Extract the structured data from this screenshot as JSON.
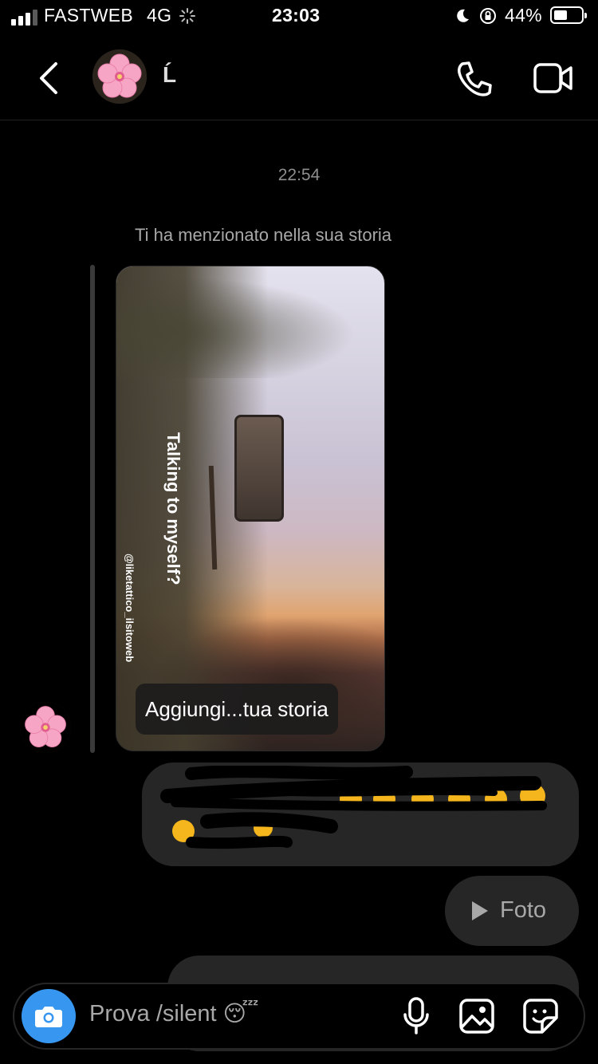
{
  "status_bar": {
    "carrier": "FASTWEB",
    "network": "4G",
    "time": "23:03",
    "battery": "44%",
    "battery_level": 0.44
  },
  "header": {
    "contact_name": "Ĺ",
    "icons": [
      "back-chevron-icon",
      "phone-icon",
      "video-camera-icon"
    ]
  },
  "chat": {
    "timestamp": "22:54",
    "mention_note": "Ti ha menzionato nella sua storia",
    "story": {
      "username_tag": "@liketattico_ilsitoweb",
      "overlay_text": "Talking to myself?",
      "add_button": "Aggiungi...tua storia"
    },
    "photo_message": {
      "label": "Foto"
    }
  },
  "composer": {
    "placeholder": "Prova /silent",
    "emoji": "😴",
    "icons": [
      "camera-icon",
      "microphone-icon",
      "gallery-icon",
      "sticker-icon"
    ]
  },
  "colors": {
    "background": "#000000",
    "bubble": "#262626",
    "accent_blue": "#3797f0",
    "secondary_text": "#a8a8a8"
  }
}
